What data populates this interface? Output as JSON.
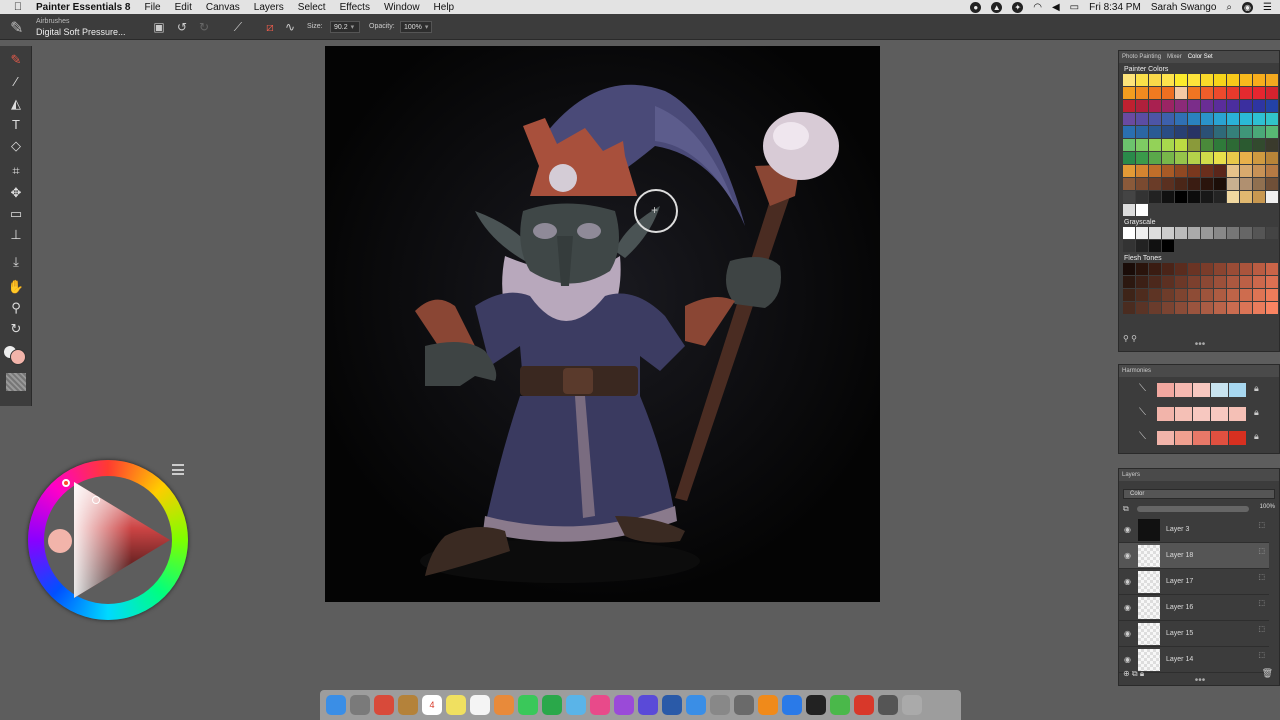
{
  "menubar": {
    "app_name": "Painter Essentials 8",
    "menus": [
      "File",
      "Edit",
      "Canvas",
      "Layers",
      "Select",
      "Effects",
      "Window",
      "Help"
    ],
    "clock": "Fri 8:34 PM",
    "user": "Sarah Swango"
  },
  "propbar": {
    "brush_category": "Airbrushes",
    "brush_variant": "Digital Soft Pressure...",
    "size_label": "Size:",
    "size_value": "90.2",
    "opacity_label": "Opacity:",
    "opacity_value": "100%"
  },
  "color": {
    "current": "#f2b4aa",
    "hue": "#ff4a2a"
  },
  "color_panel": {
    "tabs": [
      "Photo Painting",
      "Mixer",
      "Color Set"
    ],
    "active_tab": "Color Set",
    "groups": [
      {
        "title": "Painter Colors",
        "swatches": [
          "#fde47a",
          "#fbe049",
          "#f9d94a",
          "#fde34d",
          "#fbea2c",
          "#fde33b",
          "#f8d92a",
          "#f6d41a",
          "#f8ca1a",
          "#f7b91d",
          "#f7ad1c",
          "#f4a91f",
          "#f29d1f",
          "#f28a1f",
          "#f07a20",
          "#ef6f21",
          "#f5c8a3",
          "#f07522",
          "#ee5d2a",
          "#ec4a2c",
          "#e73a2c",
          "#e42a2f",
          "#e5262f",
          "#d4232e",
          "#bf2130",
          "#b0203c",
          "#a92050",
          "#9b2464",
          "#8c2a78",
          "#7b2d8a",
          "#6a2d95",
          "#5a2d9b",
          "#4b2e9e",
          "#3b2f9f",
          "#2e35a2",
          "#2342a6",
          "#6a4aa0",
          "#5b4da3",
          "#4c55a6",
          "#3d60ac",
          "#3070b4",
          "#2a82bf",
          "#2a93c9",
          "#2aa3d2",
          "#2ab1d6",
          "#2bb9d6",
          "#2ec0d2",
          "#31c4c9",
          "#2a6fb0",
          "#2b66a3",
          "#2a5a94",
          "#2a4c84",
          "#294073",
          "#283465",
          "#2b5075",
          "#2f6a79",
          "#35807a",
          "#3f9679",
          "#4aa878",
          "#58b874",
          "#6cc36d",
          "#7ecb63",
          "#93d258",
          "#a8d84d",
          "#bcdc42",
          "#8a9a3a",
          "#4a8a3a",
          "#2f7a3a",
          "#2d6a35",
          "#2b5a30",
          "#324a2e",
          "#3a3a2c",
          "#2a8a4a",
          "#3a9a4a",
          "#5aa84a",
          "#78b64a",
          "#96c44a",
          "#b4d24a",
          "#d0dc4a",
          "#e8e04a",
          "#e8c84a",
          "#e8b04a",
          "#d09a40",
          "#b88438",
          "#e39a36",
          "#d48430",
          "#c06e2a",
          "#a85a26",
          "#904822",
          "#7a381e",
          "#6a2e1c",
          "#5a261a",
          "#e6c28a",
          "#d8aa6e",
          "#c89256",
          "#b67a44",
          "#8a5a3a",
          "#7a4a30",
          "#6a3c28",
          "#5a3020",
          "#4a2618",
          "#3a1c12",
          "#2a140c",
          "#1c0e08",
          "#c8b090",
          "#b09070",
          "#907050",
          "#705038",
          "#444444",
          "#333333",
          "#222222",
          "#111111",
          "#000000",
          "#0c0c0c",
          "#181818",
          "#242424",
          "#f0d8a0",
          "#e0b870",
          "#c89850",
          "#f0f0f0",
          "#dddddd",
          "#ffffff"
        ]
      },
      {
        "title": "Grayscale",
        "swatches": [
          "#ffffff",
          "#eeeeee",
          "#dddddd",
          "#cccccc",
          "#bbbbbb",
          "#aaaaaa",
          "#999999",
          "#888888",
          "#777777",
          "#666666",
          "#555555",
          "#444444",
          "#333333",
          "#222222",
          "#111111",
          "#000000"
        ]
      },
      {
        "title": "Flesh Tones",
        "swatches": [
          "#1a0c08",
          "#2a140c",
          "#3a1c12",
          "#4a2418",
          "#5a2c1e",
          "#6a3424",
          "#7a3c2a",
          "#8a4430",
          "#9a4c36",
          "#aa543c",
          "#ba5c42",
          "#ca6448",
          "#2c1810",
          "#3c2016",
          "#4c281c",
          "#5c3022",
          "#6c3828",
          "#7c402e",
          "#8c4834",
          "#9c503a",
          "#ac5840",
          "#bc6046",
          "#cc684c",
          "#dc7052",
          "#3e2418",
          "#4e2c1e",
          "#5e3424",
          "#6e3c2a",
          "#7e4430",
          "#8e4c36",
          "#9e543c",
          "#ae5c42",
          "#be6448",
          "#ce6c4e",
          "#de7454",
          "#ee7c5a",
          "#4a2c20",
          "#5a3426",
          "#6a3c2c",
          "#7a4432",
          "#8a4c38",
          "#9a543e",
          "#aa5c44",
          "#ba644a",
          "#ca6c50",
          "#da7456",
          "#ea7c5c",
          "#fa8462"
        ]
      }
    ]
  },
  "harmonies": {
    "title": "Harmonies",
    "rows": [
      [
        "#f2a8a0",
        "#f5b8b0",
        "#f7c8c0",
        "#c8e4f0",
        "#a8d8f0"
      ],
      [
        "#f2b4aa",
        "#f5c0b6",
        "#f7c8c0",
        "#f7c8c0",
        "#f5c0b6"
      ],
      [
        "#f2b4aa",
        "#f0a090",
        "#e87868",
        "#e05040",
        "#d83020"
      ]
    ]
  },
  "layers_panel": {
    "title": "Layers",
    "composite_method": "Color",
    "opacity": "100%",
    "layers": [
      {
        "name": "Layer 3",
        "thumb": "dark",
        "selected": false
      },
      {
        "name": "Layer 18",
        "thumb": "light",
        "selected": true
      },
      {
        "name": "Layer 17",
        "thumb": "light",
        "selected": false
      },
      {
        "name": "Layer 16",
        "thumb": "light",
        "selected": false
      },
      {
        "name": "Layer 15",
        "thumb": "light",
        "selected": false
      },
      {
        "name": "Layer 14",
        "thumb": "light",
        "selected": false
      }
    ]
  },
  "dock": {
    "calendar_day": "4",
    "icons": [
      {
        "name": "finder",
        "color": "#3a8ee6"
      },
      {
        "name": "launchpad",
        "color": "#7a7a7a"
      },
      {
        "name": "chrome",
        "color": "#d84a3a"
      },
      {
        "name": "notes-folder",
        "color": "#b4823a"
      },
      {
        "name": "calendar",
        "color": "#ffffff"
      },
      {
        "name": "stickies",
        "color": "#f0e060"
      },
      {
        "name": "reminders",
        "color": "#f4f4f4"
      },
      {
        "name": "photos",
        "color": "#e88a3a"
      },
      {
        "name": "messages",
        "color": "#3ac85a"
      },
      {
        "name": "facetime",
        "color": "#2aa84a"
      },
      {
        "name": "maps",
        "color": "#5ab4e8"
      },
      {
        "name": "itunes",
        "color": "#e84a8a"
      },
      {
        "name": "podcasts",
        "color": "#9a4ad8"
      },
      {
        "name": "imovie",
        "color": "#5a4ad8"
      },
      {
        "name": "quicktime",
        "color": "#2a5aa8"
      },
      {
        "name": "app-store",
        "color": "#3a8ee6"
      },
      {
        "name": "system-preferences",
        "color": "#888888"
      },
      {
        "name": "activity-monitor",
        "color": "#6a6a6a"
      },
      {
        "name": "vlc",
        "color": "#f08a1a"
      },
      {
        "name": "messenger",
        "color": "#2a7ae8"
      },
      {
        "name": "terminal",
        "color": "#222222"
      },
      {
        "name": "upwork",
        "color": "#4ab84a"
      },
      {
        "name": "painter",
        "color": "#d8382a"
      },
      {
        "name": "downloads",
        "color": "#555555"
      },
      {
        "name": "trash",
        "color": "#aaaaaa"
      }
    ]
  }
}
